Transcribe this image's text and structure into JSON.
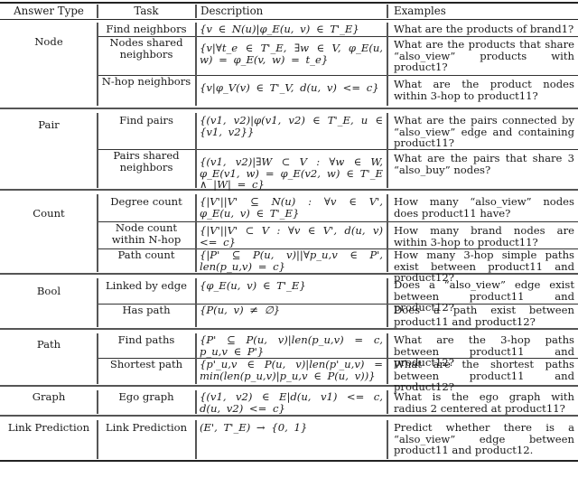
{
  "table": {
    "headers": [
      "Answer Type",
      "Task",
      "Description",
      "Examples"
    ],
    "groups": [
      {
        "answer_type": "Node",
        "rows": [
          {
            "task": "Find neighbors",
            "description": "{v ∈ N(u)|φ_E(u, v) ∈ T'_E}",
            "example": "What are the products of brand1?"
          },
          {
            "task": "Nodes shared neighbors",
            "description": "{v|∀t_e ∈ T'_E, ∃w ∈ V, φ_E(u, w) = φ_E(v, w) = t_e}",
            "example": "What are the products that share “also_view” products with product1?"
          },
          {
            "task": "N-hop neighbors",
            "description": "{v|φ_V(v) ∈ T'_V, d(u, v) <= c}",
            "example": "What are the product nodes within 3-hop to product11?"
          }
        ]
      },
      {
        "answer_type": "Pair",
        "rows": [
          {
            "task": "Find pairs",
            "description": "{(v1, v2)|φ(v1, v2) ∈ T'_E, u ∈ {v1, v2}}",
            "example": "What are the pairs connected by “also_view” edge and containing product11?"
          },
          {
            "task": "Pairs shared neighbors",
            "description": "{(v1, v2)|∃W ⊂ V : ∀w ∈ W, φ_E(v1, w) = φ_E(v2, w) ∈ T'_E ∧ |W| = c}",
            "example": "What are the pairs that share 3 “also_buy” nodes?"
          }
        ]
      },
      {
        "answer_type": "Count",
        "rows": [
          {
            "task": "Degree count",
            "description": "{|V'||V' ⊆ N(u) : ∀v ∈ V', φ_E(u, v) ∈ T'_E}",
            "example": "How many “also_view” nodes does product11 have?"
          },
          {
            "task": "Node count within N-hop",
            "description": "{|V'||V' ⊂ V : ∀v ∈ V', d(u, v) <= c}",
            "example": "How many brand nodes are within 3-hop to product11?"
          },
          {
            "task": "Path count",
            "description": "{|P' ⊆ P(u, v)||∀p_u,v ∈ P', len(p_u,v) = c}",
            "example": "How many 3-hop simple paths exist between product11 and product12?"
          }
        ]
      },
      {
        "answer_type": "Bool",
        "rows": [
          {
            "task": "Linked by edge",
            "description": "{φ_E(u, v) ∈ T'_E}",
            "example": "Does a “also_view” edge exist between product11 and product12?"
          },
          {
            "task": "Has path",
            "description": "{P(u, v) ≠ ∅}",
            "example": "Does a path exist between product11 and product12?"
          }
        ]
      },
      {
        "answer_type": "Path",
        "rows": [
          {
            "task": "Find paths",
            "description": "{P' ⊆ P(u, v)|len(p_u,v) = c, p_u,v ∈ P'}",
            "example": "What are the 3-hop paths between product11 and product12?"
          },
          {
            "task": "Shortest path",
            "description": "{p'_u,v ∈ P(u, v)|len(p'_u,v) = min(len(p_u,v)|p_u,v ∈ P(u, v))}",
            "example": "What are the shortest paths between product11 and product12?"
          }
        ]
      },
      {
        "answer_type": "Graph",
        "rows": [
          {
            "task": "Ego graph",
            "description": "{(v1, v2) ∈ E|d(u, v1) <= c, d(u, v2) <= c}",
            "example": "What is the ego graph with radius 2 centered at product11?"
          }
        ]
      },
      {
        "answer_type": "Link Prediction",
        "rows": [
          {
            "task": "Link Prediction",
            "description": "(E', T'_E) → {0, 1}",
            "example": "Predict whether there is a “also_view” edge between product11 and product12."
          }
        ]
      }
    ]
  }
}
